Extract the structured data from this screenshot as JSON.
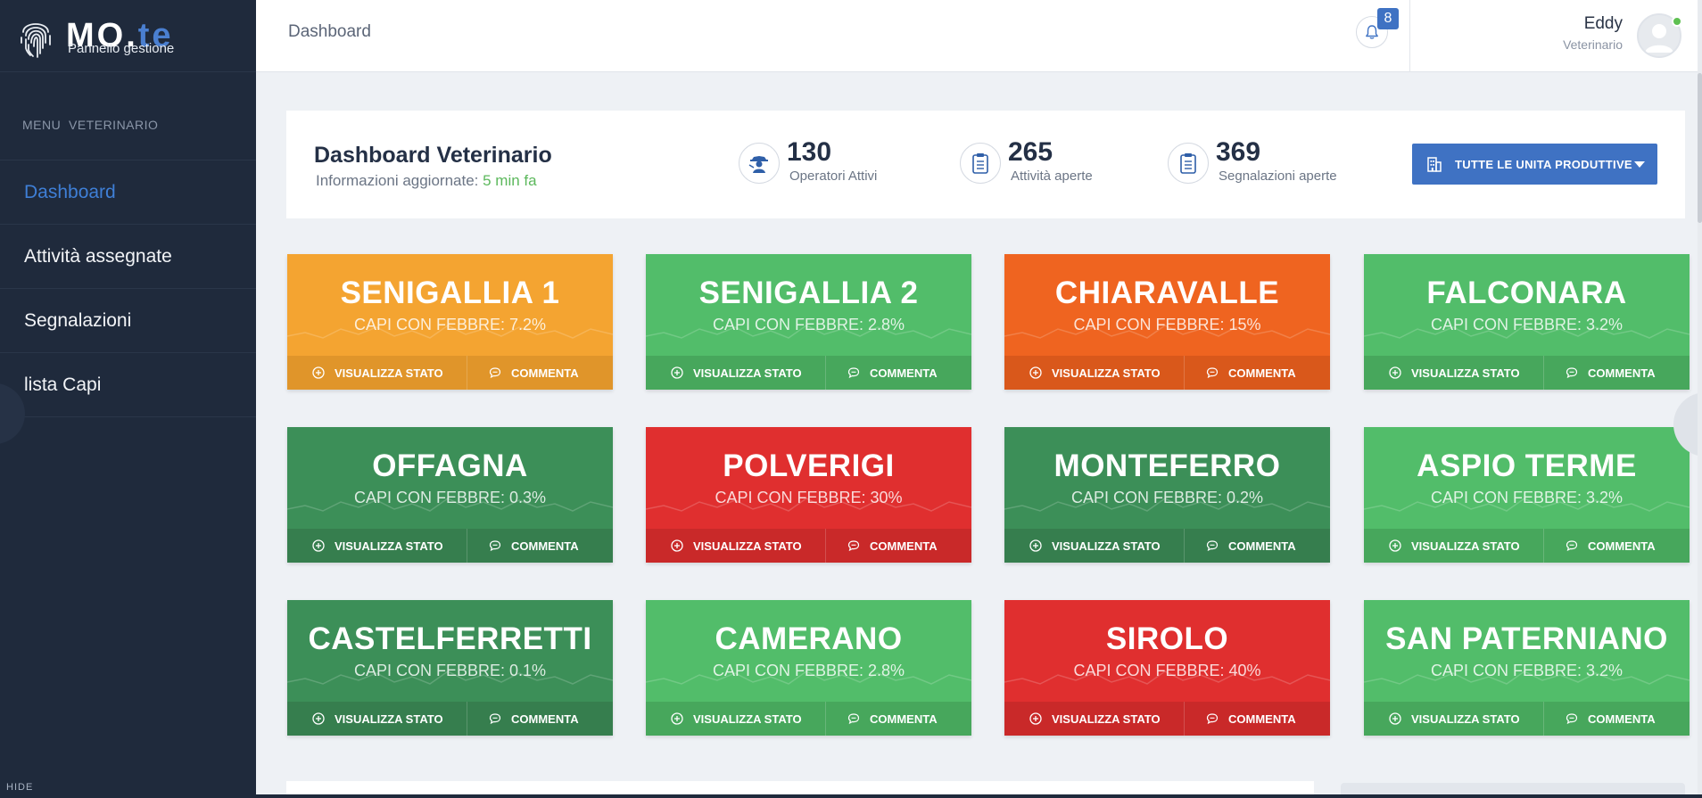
{
  "brand": {
    "name_main": "MO.",
    "name_accent": "te",
    "subtitle": "Pannello gestione"
  },
  "sidebar": {
    "menu_header": "MENU  VETERINARIO",
    "items": [
      {
        "label": "Dashboard",
        "active": true
      },
      {
        "label": "Attività assegnate",
        "active": false
      },
      {
        "label": "Segnalazioni",
        "active": false
      },
      {
        "label": "lista Capi",
        "active": false
      }
    ],
    "hide_label": "HIDE"
  },
  "topbar": {
    "breadcrumb": "Dashboard",
    "notifications_count": "8",
    "user_name": "Eddy",
    "user_role": "Veterinario"
  },
  "summary": {
    "title": "Dashboard Veterinario",
    "updated_label": "Informazioni aggiornate: ",
    "updated_value": "5 min fa",
    "stats": [
      {
        "value": "130",
        "label": "Operatori Attivi",
        "icon": "operator-icon"
      },
      {
        "value": "265",
        "label": "Attività aperte",
        "icon": "clipboard-icon"
      },
      {
        "value": "369",
        "label": "Segnalazioni aperte",
        "icon": "clipboard-icon"
      }
    ],
    "unit_button": "TUTTE LE UNITA PRODUTTIVE"
  },
  "card_actions": {
    "view": "VISUALIZZA STATO",
    "comment": "COMMENTA"
  },
  "cards": [
    {
      "name": "SENIGALLIA 1",
      "fever": "CAPI CON FEBBRE: 7.2%",
      "color": "orange"
    },
    {
      "name": "SENIGALLIA 2",
      "fever": "CAPI CON FEBBRE: 2.8%",
      "color": "green"
    },
    {
      "name": "CHIARAVALLE",
      "fever": "CAPI CON FEBBRE: 15%",
      "color": "dorange"
    },
    {
      "name": "FALCONARA",
      "fever": "CAPI CON FEBBRE: 3.2%",
      "color": "green"
    },
    {
      "name": "OFFAGNA",
      "fever": "CAPI CON FEBBRE: 0.3%",
      "color": "dgreen"
    },
    {
      "name": "POLVERIGI",
      "fever": "CAPI CON FEBBRE: 30%",
      "color": "red"
    },
    {
      "name": "MONTEFERRO",
      "fever": "CAPI CON FEBBRE: 0.2%",
      "color": "dgreen"
    },
    {
      "name": "ASPIO TERME",
      "fever": "CAPI CON FEBBRE: 3.2%",
      "color": "green"
    },
    {
      "name": "CASTELFERRETTI",
      "fever": "CAPI CON FEBBRE: 0.1%",
      "color": "dgreen"
    },
    {
      "name": "CAMERANO",
      "fever": "CAPI CON FEBBRE: 2.8%",
      "color": "green"
    },
    {
      "name": "SIROLO",
      "fever": "CAPI CON FEBBRE: 40%",
      "color": "red"
    },
    {
      "name": "SAN PATERNIANO",
      "fever": "CAPI CON FEBBRE: 3.2%",
      "color": "green"
    }
  ],
  "colors": {
    "sidebar_bg": "#1f2a3c",
    "accent_blue": "#3f72c3",
    "orange": "#f4a431",
    "green": "#52bd6a",
    "dark_orange": "#ef6420",
    "dark_green": "#3c8f58",
    "red": "#e02f2f"
  }
}
